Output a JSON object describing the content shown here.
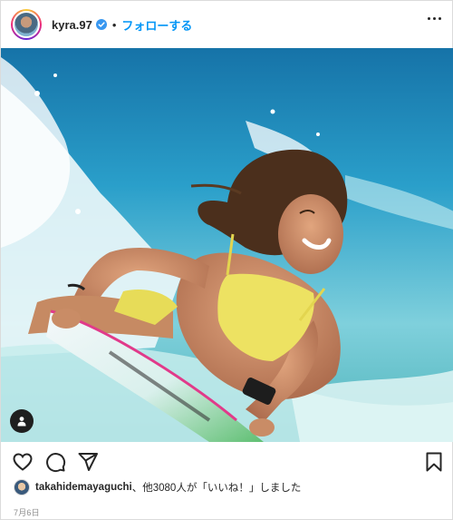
{
  "header": {
    "username": "kyra.97",
    "separator": "•",
    "follow_label": "フォローする"
  },
  "icons": {
    "verified": "verified-badge-icon",
    "more": "more-options-icon",
    "user_tag": "user-tag-icon",
    "like": "heart-icon",
    "comment": "comment-icon",
    "share": "paper-plane-icon",
    "save": "bookmark-icon"
  },
  "colors": {
    "accent": "#0095f6",
    "text": "#262626",
    "muted": "#8e8e8e"
  },
  "likes": {
    "liker": "takahidemayaguchi",
    "rest": "、他3080人が「いいね！」しました"
  },
  "date": "7月6日"
}
